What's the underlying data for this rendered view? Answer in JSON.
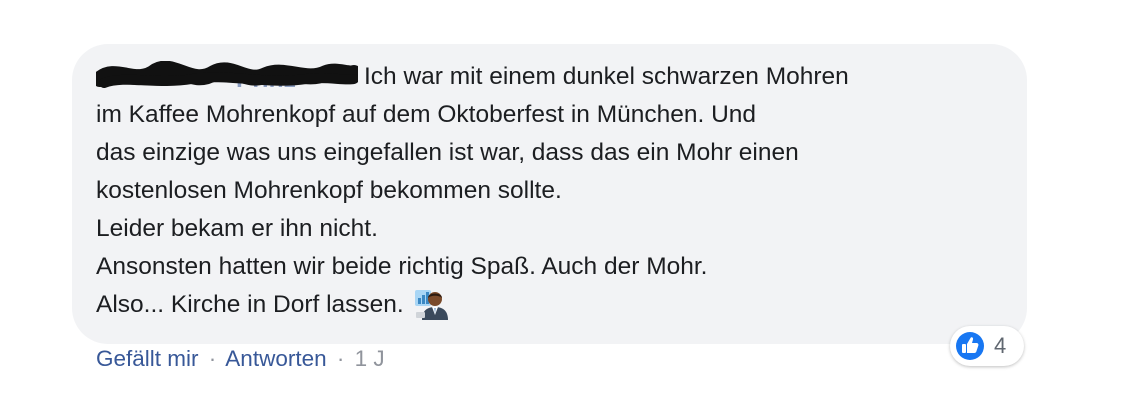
{
  "comment": {
    "author_partial": "Prinz",
    "author_redacted": true,
    "lines": [
      "Ich war mit einem dunkel schwarzen Mohren",
      "im Kaffee Mohrenkopf auf dem Oktoberfest in München. Und",
      "das einzige was uns eingefallen ist war, dass das ein Mohr einen",
      "kostenlosen Mohrenkopf bekommen sollte.",
      "Leider bekam er ihn nicht.",
      "Ansonsten hatten wir beide richtig Spaß. Auch der Mohr.",
      "Also... Kirche in Dorf lassen."
    ],
    "emoji": "man-office-worker-dark-skin-tone-emoji"
  },
  "actions": {
    "like_label": "Gefällt mir",
    "separator": "·",
    "reply_label": "Antworten",
    "timestamp": "1 J"
  },
  "reactions": {
    "icon": "like-thumbs-up-icon",
    "count": "4"
  },
  "colors": {
    "bubble": "#f2f3f5",
    "text": "#1c1e21",
    "link": "#385898",
    "meta": "#90949c",
    "like_blue": "#1877f2"
  }
}
